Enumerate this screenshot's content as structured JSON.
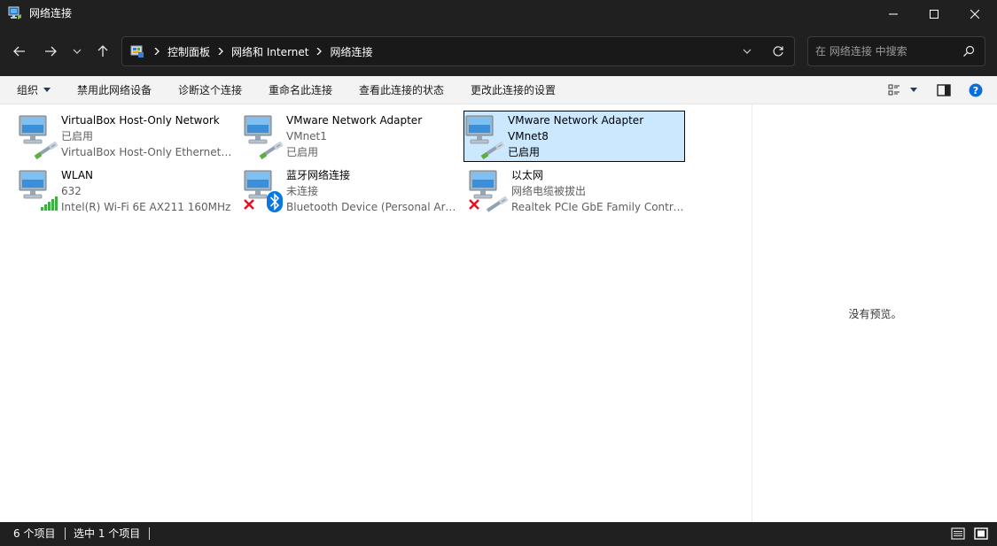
{
  "window": {
    "title": "网络连接",
    "icon": "network-connections-icon"
  },
  "address": {
    "icon": "control-panel-icon",
    "breadcrumbs": [
      "控制面板",
      "网络和 Internet",
      "网络连接"
    ]
  },
  "search": {
    "placeholder": "在 网络连接 中搜索"
  },
  "toolbar": {
    "organize": "组织",
    "actions": [
      "禁用此网络设备",
      "诊断这个连接",
      "重命名此连接",
      "查看此连接的状态",
      "更改此连接的设置"
    ]
  },
  "connections": [
    {
      "name": "VirtualBox Host-Only Network",
      "line2": "已启用",
      "line3": "VirtualBox Host-Only Ethernet Adapter",
      "icon": "ethernet-adapter-icon",
      "status": "enabled",
      "selected": false
    },
    {
      "name": "VMware Network Adapter",
      "line2": "VMnet1",
      "line3": "已启用",
      "icon": "ethernet-adapter-icon",
      "status": "enabled",
      "selected": false
    },
    {
      "name": "VMware Network Adapter",
      "line2": "VMnet8",
      "line3": "已启用",
      "icon": "ethernet-adapter-icon",
      "status": "enabled",
      "selected": true
    },
    {
      "name": "WLAN",
      "line2": "632",
      "line3": "Intel(R) Wi-Fi 6E AX211 160MHz",
      "icon": "wifi-signal-icon",
      "status": "connected",
      "selected": false
    },
    {
      "name": "蓝牙网络连接",
      "line2": "未连接",
      "line3": "Bluetooth Device (Personal Area Network)",
      "icon": "bluetooth-icon",
      "status": "disconnected",
      "selected": false
    },
    {
      "name": "以太网",
      "line2": "网络电缆被拔出",
      "line3": "Realtek PCIe GbE Family Controller",
      "icon": "ethernet-adapter-icon",
      "status": "disconnected",
      "selected": false
    }
  ],
  "preview": {
    "text": "没有预览。"
  },
  "statusbar": {
    "count": "6 个项目",
    "selected": "选中 1 个项目"
  },
  "colors": {
    "dark_chrome": "#202020",
    "selection": "#cce8ff",
    "accent": "#0078d4",
    "bluetooth": "#0a78e0",
    "error_x": "#e81123",
    "signal": "#3cb043"
  }
}
